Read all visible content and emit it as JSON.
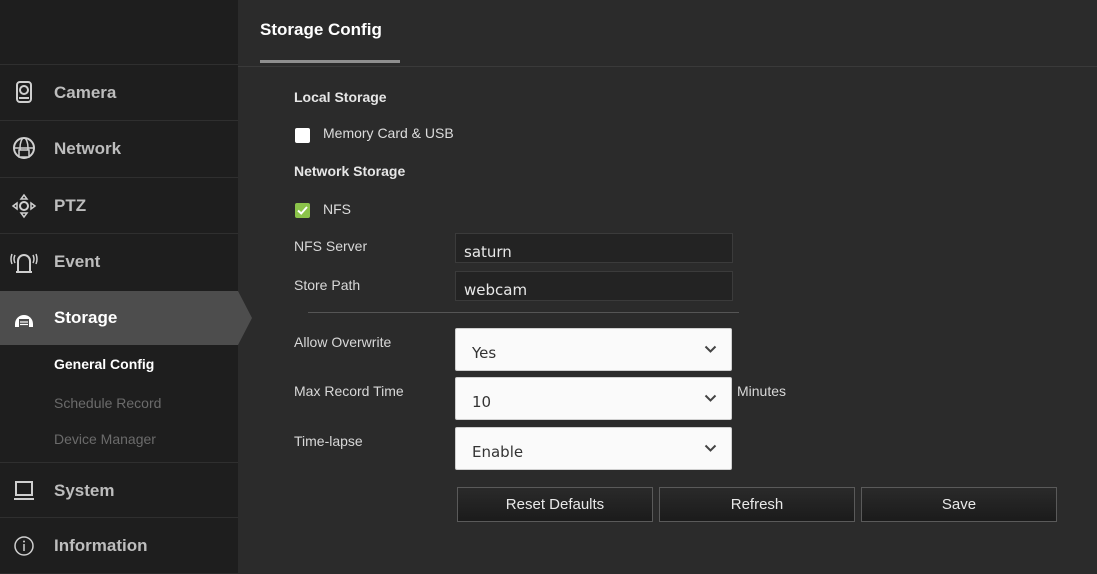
{
  "header": {
    "title": "Storage Config"
  },
  "sidebar": {
    "items": [
      {
        "label": "Camera",
        "icon": "camera-icon"
      },
      {
        "label": "Network",
        "icon": "network-globe-icon"
      },
      {
        "label": "PTZ",
        "icon": "ptz-icon"
      },
      {
        "label": "Event",
        "icon": "event-alarm-icon"
      },
      {
        "label": "Storage",
        "icon": "storage-icon",
        "active": true
      },
      {
        "label": "System",
        "icon": "system-monitor-icon"
      },
      {
        "label": "Information",
        "icon": "info-icon"
      }
    ],
    "subitems": [
      {
        "label": "General Config",
        "active": true
      },
      {
        "label": "Schedule Record"
      },
      {
        "label": "Device Manager"
      }
    ]
  },
  "main": {
    "local_storage": {
      "heading": "Local Storage",
      "memory_card": {
        "label": "Memory Card & USB",
        "checked": false
      }
    },
    "network_storage": {
      "heading": "Network Storage",
      "nfs": {
        "label": "NFS",
        "checked": true
      },
      "nfs_server": {
        "label": "NFS Server",
        "value": "saturn"
      },
      "store_path": {
        "label": "Store Path",
        "value": "webcam"
      }
    },
    "allow_overwrite": {
      "label": "Allow Overwrite",
      "value": "Yes"
    },
    "max_record_time": {
      "label": "Max Record Time",
      "value": "10",
      "unit": "Minutes"
    },
    "time_lapse": {
      "label": "Time-lapse",
      "value": "Enable"
    },
    "buttons": {
      "reset": "Reset Defaults",
      "refresh": "Refresh",
      "save": "Save"
    }
  },
  "colors": {
    "accent_check": "#8bc34a",
    "sidebar_bg": "#1e1e1e",
    "content_bg": "#2b2b2b"
  }
}
